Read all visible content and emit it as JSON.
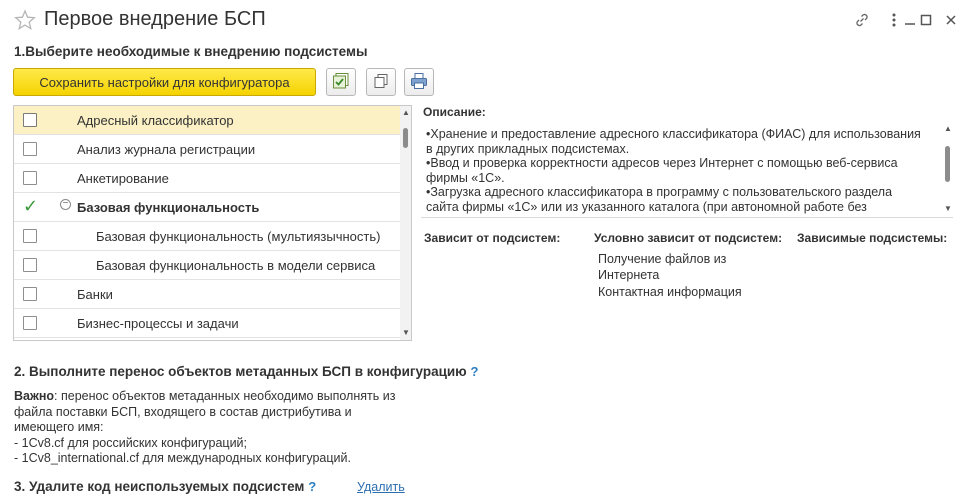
{
  "window": {
    "title": "Первое внедрение БСП",
    "icons": [
      "star-icon",
      "link-icon",
      "more-icon",
      "minimize-icon",
      "maximize-icon",
      "close-icon"
    ]
  },
  "step1": {
    "heading": "1.Выберите необходимые к внедрению подсистемы",
    "save_button": "Сохранить настройки для конфигуратора",
    "toolbar_icons": [
      "check-all-icon",
      "copy-icon",
      "print-icon"
    ]
  },
  "subsystems": [
    {
      "label": "Адресный классификатор",
      "checked": false,
      "selected": true,
      "indent": 0
    },
    {
      "label": "Анализ журнала регистрации",
      "checked": false,
      "selected": false,
      "indent": 0
    },
    {
      "label": "Анкетирование",
      "checked": false,
      "selected": false,
      "indent": 0
    },
    {
      "label": "Базовая функциональность",
      "checked": true,
      "selected": false,
      "indent": 0,
      "group": true
    },
    {
      "label": "Базовая функциональность (мультиязычность)",
      "checked": false,
      "selected": false,
      "indent": 1
    },
    {
      "label": "Базовая функциональность в модели сервиса",
      "checked": false,
      "selected": false,
      "indent": 1
    },
    {
      "label": "Банки",
      "checked": false,
      "selected": false,
      "indent": 0
    },
    {
      "label": "Бизнес-процессы и задачи",
      "checked": false,
      "selected": false,
      "indent": 0
    }
  ],
  "description": {
    "label": "Описание:",
    "lines": [
      "•Хранение и предоставление адресного классификатора (ФИАС) для использования",
      "в других прикладных подсистемах.",
      "•Ввод и проверка корректности адресов через Интернет с помощью веб-сервиса",
      "фирмы «1С».",
      "•Загрузка адресного классификатора в программу с пользовательского раздела",
      "сайта фирмы «1С» или из указанного каталога (при автономной работе без"
    ]
  },
  "dependencies": {
    "depends_on_label": "Зависит от подсистем:",
    "conditional_label": "Условно зависит от подсистем:",
    "dependent_label": "Зависимые подсистемы:",
    "conditional_items": [
      "Получение файлов из",
      "Интернета",
      "Контактная информация"
    ]
  },
  "step2": {
    "heading": "2. Выполните перенос объектов метаданных БСП в конфигурацию",
    "help": "?",
    "important_label": "Важно",
    "lines": [
      ": перенос объектов метаданных необходимо выполнять из",
      "файла поставки БСП, входящего в состав дистрибутива и",
      "имеющего имя:",
      "- 1Cv8.cf для российских конфигураций;",
      "- 1Cv8_international.cf для международных конфигураций."
    ]
  },
  "step3": {
    "heading": "3. Удалите код неиспользуемых подсистем",
    "help": "?",
    "delete_link": "Удалить"
  },
  "colors": {
    "accent_yellow": "#f5d300",
    "selected_row": "#fbf1c4",
    "check_green": "#3a9a3a",
    "link_blue": "#2e6fb0"
  }
}
